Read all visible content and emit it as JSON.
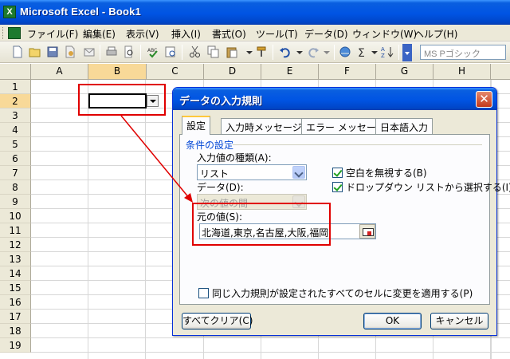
{
  "window": {
    "title": "Microsoft Excel - Book1"
  },
  "menu": [
    {
      "label": "ファイル(F)"
    },
    {
      "label": "編集(E)"
    },
    {
      "label": "表示(V)"
    },
    {
      "label": "挿入(I)"
    },
    {
      "label": "書式(O)"
    },
    {
      "label": "ツール(T)"
    },
    {
      "label": "データ(D)"
    },
    {
      "label": "ウィンドウ(W)"
    },
    {
      "label": "ヘルプ(H)"
    }
  ],
  "toolbar": {
    "font_name": "MS Pゴシック",
    "icons": [
      "new-icon",
      "open-icon",
      "save-icon",
      "permission-icon",
      "email-icon",
      "print-icon",
      "print-preview-icon",
      "spelling-icon",
      "research-icon",
      "cut-icon",
      "copy-icon",
      "paste-icon",
      "format-painter-icon",
      "undo-icon",
      "redo-icon",
      "hyperlink-icon",
      "autosum-icon",
      "sort-icon"
    ]
  },
  "grid": {
    "columns": [
      "A",
      "B",
      "C",
      "D",
      "E",
      "F",
      "G",
      "H"
    ],
    "rows": [
      "1",
      "2",
      "3",
      "4",
      "5",
      "6",
      "7",
      "8",
      "9",
      "10",
      "11",
      "12",
      "13",
      "14",
      "15",
      "16",
      "17",
      "18",
      "19"
    ],
    "active_cell": "B2"
  },
  "dialog": {
    "title": "データの入力規則",
    "tabs": [
      "設定",
      "入力時メッセージ",
      "エラー メッセージ",
      "日本語入力"
    ],
    "active_tab": "設定",
    "group_label": "条件の設定",
    "allow_label": "入力値の種類(A):",
    "allow_value": "リスト",
    "data_label": "データ(D):",
    "data_value": "次の値の間",
    "ignore_blank": {
      "label": "空白を無視する(B)",
      "checked": true
    },
    "in_cell_dropdown": {
      "label": "ドロップダウン リストから選択する(I)",
      "checked": true
    },
    "source_label": "元の値(S):",
    "source_value": "北海道,東京,名古屋,大阪,福岡",
    "apply_all": {
      "label": "同じ入力規則が設定されたすべてのセルに変更を適用する(P)",
      "checked": false
    },
    "clear_all": "すべてクリア(C)",
    "ok": "OK",
    "cancel": "キャンセル"
  },
  "colors": {
    "title_blue": "#0054e3",
    "highlight_red": "#e00000",
    "selected_header": "#f8d998"
  }
}
